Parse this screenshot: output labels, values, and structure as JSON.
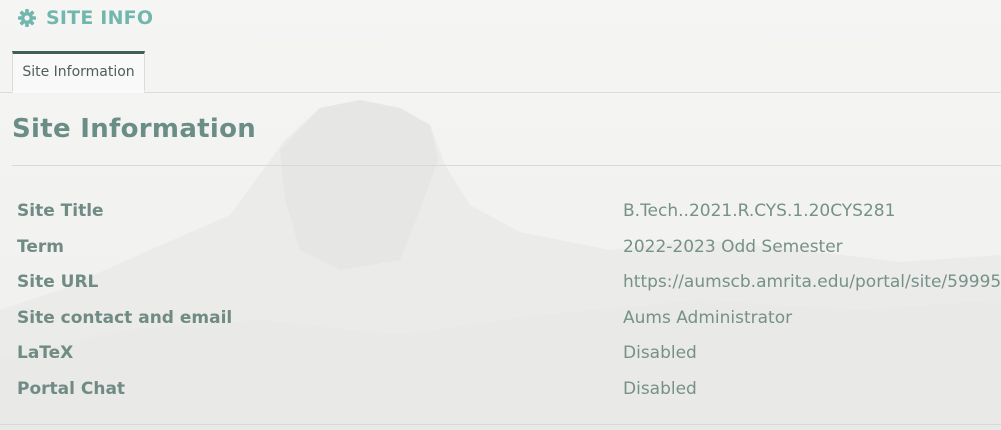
{
  "tool": {
    "icon": "gear-icon",
    "title": "SITE INFO"
  },
  "tabs": [
    {
      "label": "Site Information",
      "active": true
    }
  ],
  "page": {
    "title": "Site Information"
  },
  "info": {
    "rows": [
      {
        "label": "Site Title",
        "value": "B.Tech..2021.R.CYS.1.20CYS281"
      },
      {
        "label": "Term",
        "value": "2022-2023 Odd Semester"
      },
      {
        "label": "Site URL",
        "value": "https://aumscb.amrita.edu/portal/site/59995"
      },
      {
        "label": "Site contact and email",
        "value": "Aums Administrator"
      },
      {
        "label": "LaTeX",
        "value": "Disabled"
      },
      {
        "label": "Portal Chat",
        "value": "Disabled"
      }
    ]
  },
  "colors": {
    "accent": "#72b7ad",
    "tab_border": "#3f5f5a",
    "text": "#6e8a83"
  }
}
